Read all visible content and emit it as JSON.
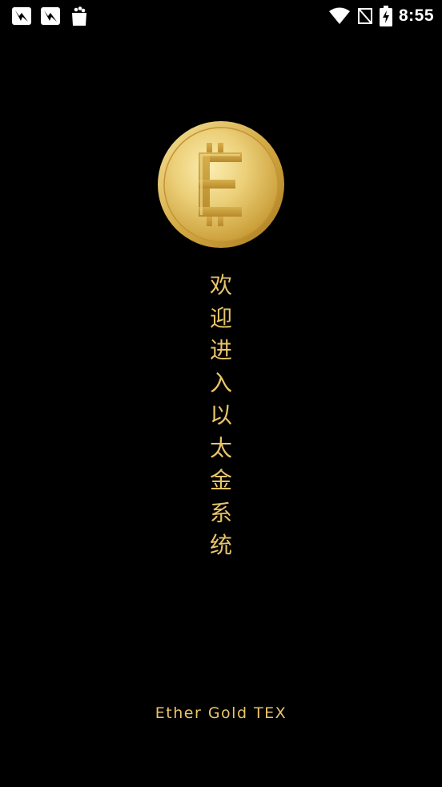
{
  "status_bar": {
    "time": "8:55",
    "notification_icons": [
      "app-notification-icon",
      "app-notification-icon",
      "shopping-bag-icon"
    ],
    "system_icons": [
      "wifi-icon",
      "no-signal-icon",
      "battery-charging-icon"
    ]
  },
  "splash": {
    "logo_icon": "ether-gold-coin-icon",
    "logo_letter": "E",
    "welcome_chars": [
      "欢",
      "迎",
      "进",
      "入",
      "以",
      "太",
      "金",
      "系",
      "统"
    ],
    "brand": "Ether Gold TEX"
  },
  "colors": {
    "background": "#000000",
    "accent_gold": "#e8c46a",
    "coin_gold": "#d9b24a"
  }
}
